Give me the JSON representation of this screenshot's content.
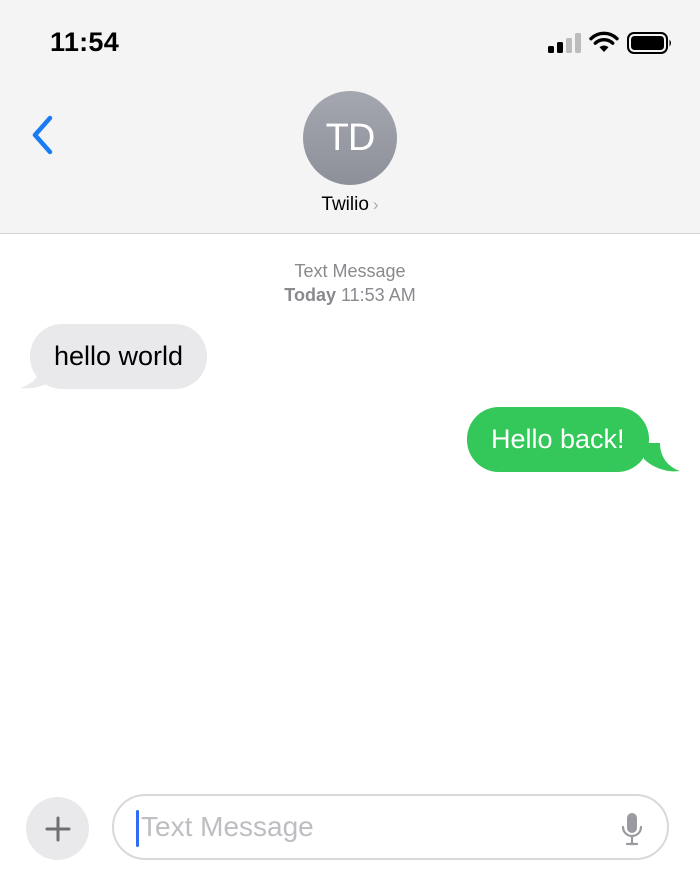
{
  "status_bar": {
    "time": "11:54",
    "signal_icon": "signal-bars-icon",
    "wifi_icon": "wifi-icon",
    "battery_icon": "battery-icon"
  },
  "nav": {
    "back_icon": "chevron-left-icon",
    "avatar_initials": "TD",
    "contact_name": "Twilio",
    "contact_chevron": "›"
  },
  "thread": {
    "meta_label": "Text Message",
    "meta_day": "Today",
    "meta_time": "11:53 AM",
    "messages": [
      {
        "direction": "received",
        "text": "hello world"
      },
      {
        "direction": "sent",
        "text": "Hello back!"
      }
    ]
  },
  "composer": {
    "plus_icon": "plus-icon",
    "placeholder": "Text Message",
    "value": "",
    "mic_icon": "microphone-icon"
  },
  "colors": {
    "accent_blue": "#1a7cf5",
    "sent_green": "#34c759",
    "received_gray": "#e9e9eb",
    "header_bg": "#f4f4f4"
  }
}
